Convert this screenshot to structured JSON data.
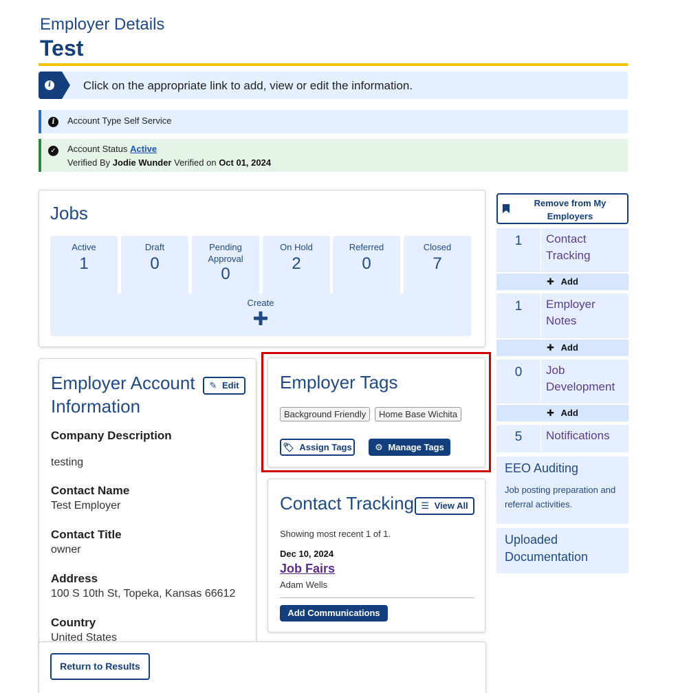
{
  "header": {
    "breadcrumb": "Employer Details",
    "title": "Test"
  },
  "info_banner": {
    "text": "Click on the appropriate link to add, view or edit the information."
  },
  "account_type": {
    "text": "Account Type Self Service"
  },
  "account_status": {
    "label": "Account Status",
    "status": "Active",
    "verified_by_label": "Verified By",
    "verified_by": "Jodie Wunder",
    "verified_on_label": "Verified on",
    "verified_on": "Oct 01, 2024"
  },
  "jobs": {
    "title": "Jobs",
    "tiles": [
      {
        "label": "Active",
        "value": "1"
      },
      {
        "label": "Draft",
        "value": "0"
      },
      {
        "label": "Pending Approval",
        "value": "0"
      },
      {
        "label": "On Hold",
        "value": "2"
      },
      {
        "label": "Referred",
        "value": "0"
      },
      {
        "label": "Closed",
        "value": "7"
      }
    ],
    "create_label": "Create"
  },
  "sidebar": {
    "remove_button": "Remove from My Employers",
    "stats": [
      {
        "count": "1",
        "label": "Contact Tracking",
        "add_label": "Add"
      },
      {
        "count": "1",
        "label": "Employer Notes",
        "add_label": "Add"
      },
      {
        "count": "0",
        "label": "Job Development",
        "add_label": "Add"
      },
      {
        "count": "5",
        "label": "Notifications"
      }
    ],
    "eeo": {
      "title": "EEO Auditing",
      "description": "Job posting preparation and referral activities."
    },
    "uploaded": {
      "title": "Uploaded Documentation"
    }
  },
  "account_info": {
    "title": "Employer Account Information",
    "edit_label": "Edit",
    "fields": [
      {
        "label": "Company Description",
        "value": "testing"
      },
      {
        "label": "Contact Name",
        "value": "Test Employer"
      },
      {
        "label": "Contact Title",
        "value": "owner"
      },
      {
        "label": "Address",
        "value": "100 S 10th St, Topeka, Kansas 66612"
      },
      {
        "label": "Country",
        "value": "United States"
      }
    ]
  },
  "tags": {
    "title": "Employer Tags",
    "chips": [
      "Background Friendly",
      "Home Base Wichita"
    ],
    "assign_label": "Assign Tags",
    "manage_label": "Manage Tags"
  },
  "contact_tracking": {
    "title": "Contact Tracking",
    "view_all_label": "View All",
    "summary": "Showing most recent 1 of 1.",
    "date": "Dec 10, 2024",
    "entry_title": "Job Fairs",
    "entry_person": "Adam Wells",
    "add_label": "Add Communications"
  },
  "footer": {
    "return_label": "Return to Results"
  },
  "colors": {
    "navy": "#143f7e",
    "accent_yellow": "#f2c300",
    "highlight_red": "#d00000",
    "link_purple": "#5c2d91"
  }
}
